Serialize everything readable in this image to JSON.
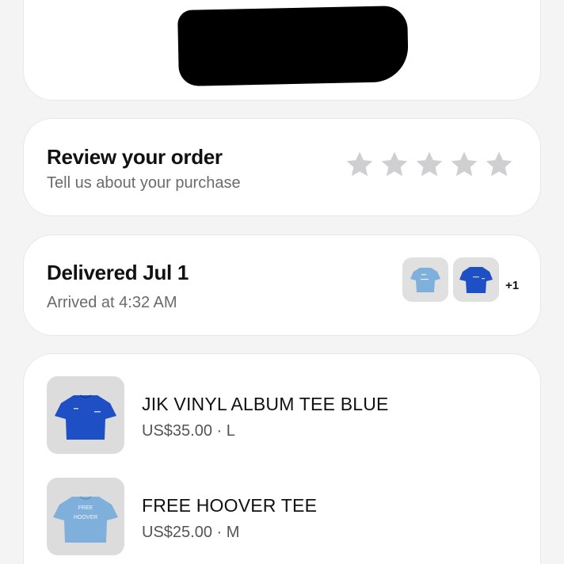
{
  "review": {
    "title": "Review your order",
    "subtitle": "Tell us about your purchase",
    "rating_filled": 0,
    "rating_max": 5
  },
  "delivery": {
    "title": "Delivered Jul 1",
    "subtitle": "Arrived at 4:32 AM",
    "more_count": "+1"
  },
  "items": [
    {
      "name": "JIK VINYL ALBUM TEE BLUE",
      "meta": "US$35.00 · L",
      "color": "#1f4fc4"
    },
    {
      "name": "FREE HOOVER TEE",
      "meta": "US$25.00 · M",
      "color": "#7fb0dc",
      "print_text": [
        "FREE",
        "HOOVER"
      ]
    }
  ],
  "colors": {
    "star_empty": "#cfcfd1",
    "card_bg": "#ffffff",
    "page_bg": "#f4f4f5"
  }
}
